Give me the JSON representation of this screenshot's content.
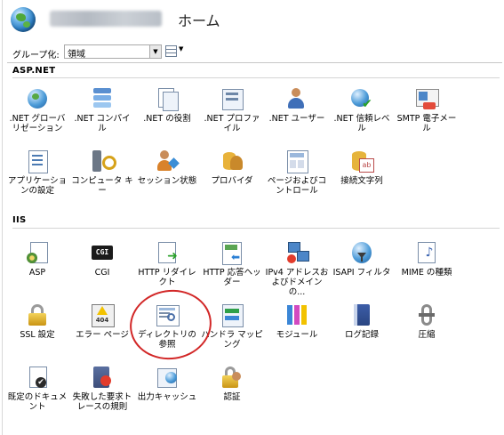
{
  "header": {
    "title": "ホーム"
  },
  "toolbar": {
    "group_label": "グループ化:",
    "group_value": "領域"
  },
  "sections": [
    {
      "name": "ASP.NET",
      "items": [
        {
          "label": ".NET グローバリゼーション",
          "icon": "globe-icon"
        },
        {
          "label": ".NET コンパイル",
          "icon": "compile-icon"
        },
        {
          "label": ".NET の役割",
          "icon": "roles-icon"
        },
        {
          "label": ".NET プロファイル",
          "icon": "profile-icon"
        },
        {
          "label": ".NET ユーザー",
          "icon": "users-icon"
        },
        {
          "label": ".NET 信頼レベル",
          "icon": "trust-level-icon"
        },
        {
          "label": "SMTP 電子メール",
          "icon": "smtp-mail-icon"
        },
        {
          "label": "アプリケーションの設定",
          "icon": "app-settings-icon"
        },
        {
          "label": "コンピュータ キー",
          "icon": "machine-key-icon"
        },
        {
          "label": "セッション状態",
          "icon": "session-state-icon"
        },
        {
          "label": "プロバイダ",
          "icon": "providers-icon"
        },
        {
          "label": "ページおよびコントロール",
          "icon": "pages-controls-icon"
        },
        {
          "label": "接続文字列",
          "icon": "connection-strings-icon"
        }
      ]
    },
    {
      "name": "IIS",
      "items": [
        {
          "label": "ASP",
          "icon": "asp-icon"
        },
        {
          "label": "CGI",
          "icon": "cgi-icon"
        },
        {
          "label": "HTTP リダイレクト",
          "icon": "http-redirect-icon"
        },
        {
          "label": "HTTP 応答ヘッダー",
          "icon": "http-response-headers-icon"
        },
        {
          "label": "IPv4 アドレスおよびドメインの...",
          "icon": "ipv4-restrictions-icon"
        },
        {
          "label": "ISAPI フィルタ",
          "icon": "isapi-filters-icon"
        },
        {
          "label": "MIME の種類",
          "icon": "mime-types-icon"
        },
        {
          "label": "SSL 設定",
          "icon": "ssl-lock-icon"
        },
        {
          "label": "エラー ページ",
          "icon": "error-pages-icon"
        },
        {
          "label": "ディレクトリの参照",
          "icon": "directory-browsing-icon"
        },
        {
          "label": "ハンドラ マッピング",
          "icon": "handler-mappings-icon"
        },
        {
          "label": "モジュール",
          "icon": "modules-icon"
        },
        {
          "label": "ログ記録",
          "icon": "logging-icon"
        },
        {
          "label": "圧縮",
          "icon": "compression-icon"
        },
        {
          "label": "既定のドキュメント",
          "icon": "default-document-icon"
        },
        {
          "label": "失敗した要求トレースの規則",
          "icon": "failed-request-tracing-icon"
        },
        {
          "label": "出力キャッシュ",
          "icon": "output-caching-icon"
        },
        {
          "label": "認証",
          "icon": "authentication-icon"
        }
      ]
    }
  ]
}
